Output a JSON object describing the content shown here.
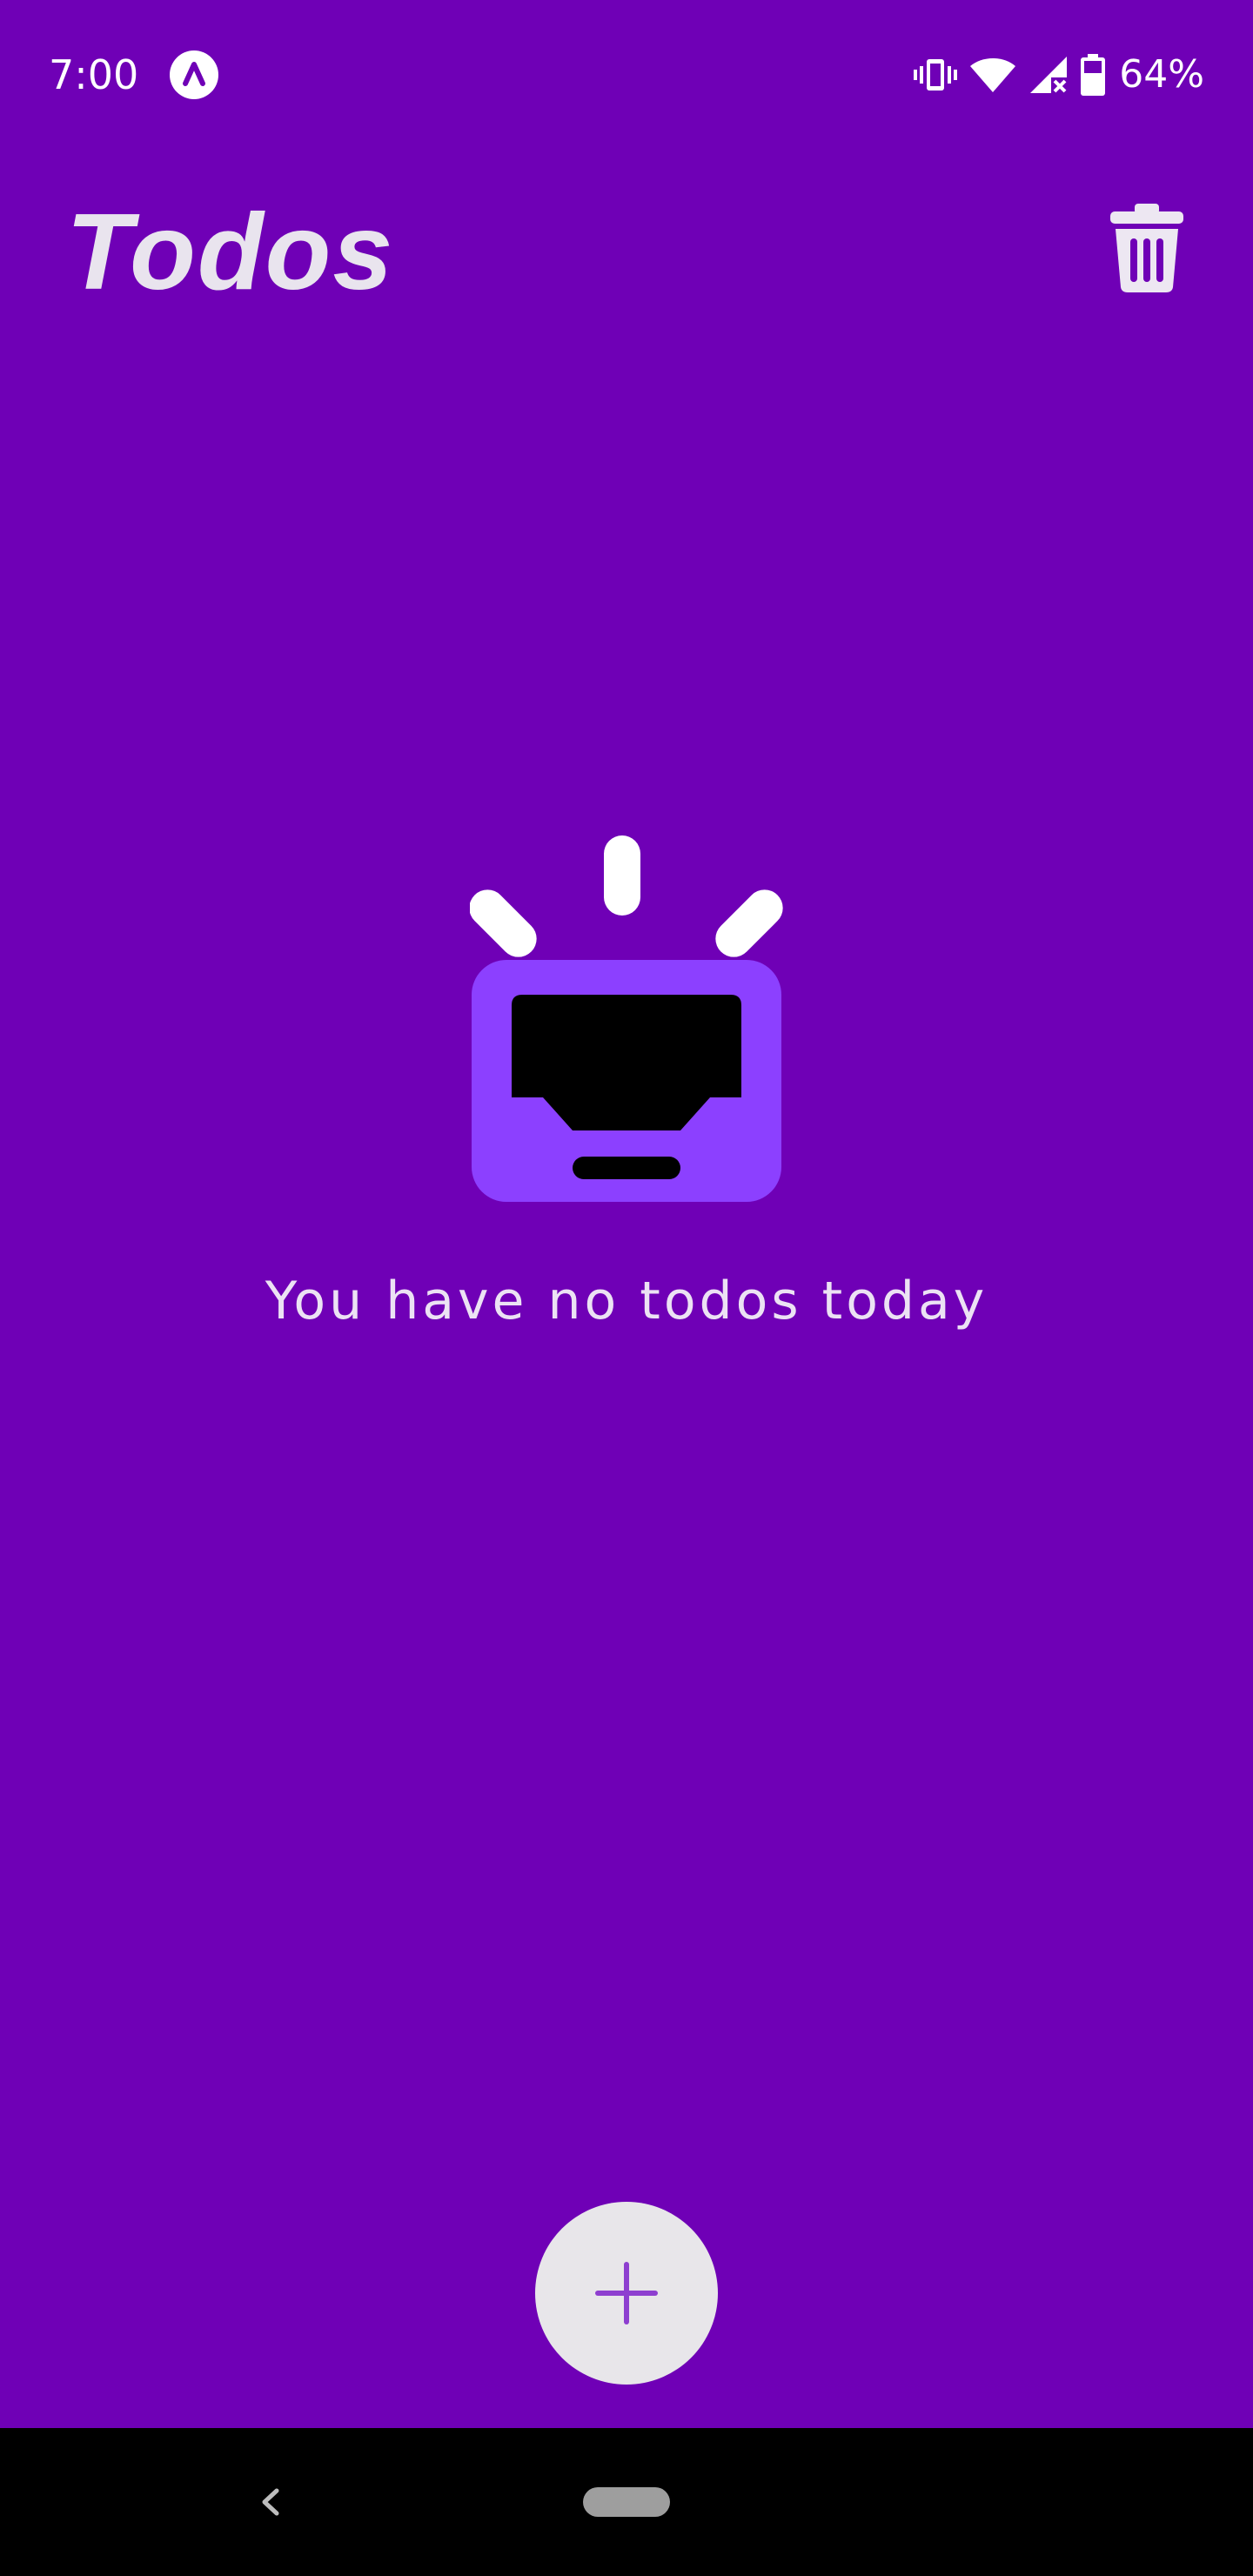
{
  "status_bar": {
    "time": "7:00",
    "battery_percent": "64%",
    "battery_level": 0.64,
    "icons": [
      "app-notification-icon",
      "vibrate-icon",
      "wifi-icon",
      "cellular-no-signal-icon",
      "battery-icon"
    ]
  },
  "app_bar": {
    "title": "Todos",
    "action_icon": "trash-icon"
  },
  "empty_state": {
    "illustration_icon": "empty-inbox-icon",
    "message": "You have no todos today"
  },
  "fab": {
    "icon": "plus-icon"
  },
  "navigation_bar": {
    "icons": [
      "back-icon",
      "home-pill-icon"
    ]
  },
  "colors": {
    "background": "#6F00B6",
    "title_text": "#E9E4EE",
    "illustration_box": "#8C40FF",
    "fab_background": "#E8E6EA",
    "fab_icon": "#8E3FD0",
    "nav_bar": "#000000"
  }
}
